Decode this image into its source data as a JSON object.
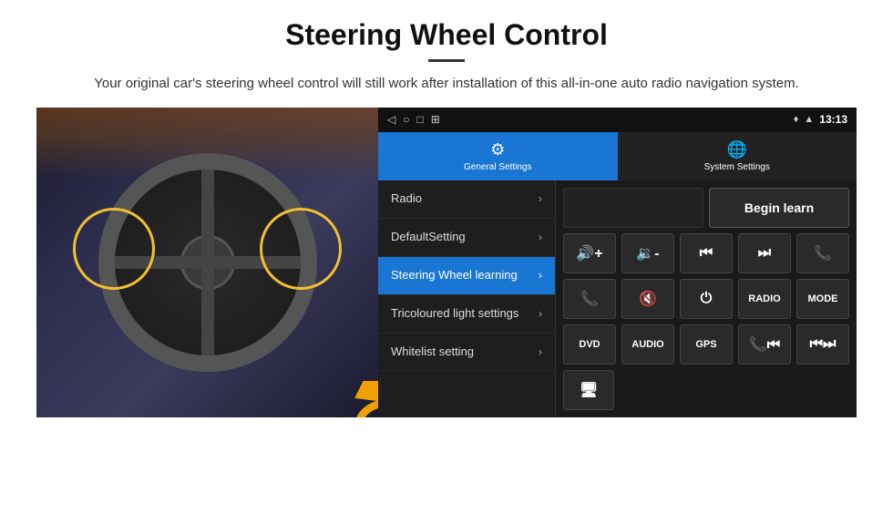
{
  "header": {
    "title": "Steering Wheel Control",
    "divider": true,
    "subtitle": "Your original car's steering wheel control will still work after installation of this all-in-one auto radio navigation system."
  },
  "status_bar": {
    "back_icon": "◁",
    "home_icon": "○",
    "square_icon": "□",
    "grid_icon": "⊞",
    "gps_icon": "♦",
    "signal_icon": "▲",
    "time": "13:13"
  },
  "tabs": [
    {
      "id": "general",
      "icon": "⚙",
      "label": "General Settings",
      "active": true
    },
    {
      "id": "system",
      "icon": "🌐",
      "label": "System Settings",
      "active": false
    }
  ],
  "menu_items": [
    {
      "id": "radio",
      "label": "Radio",
      "active": false
    },
    {
      "id": "default",
      "label": "DefaultSetting",
      "active": false
    },
    {
      "id": "steering",
      "label": "Steering Wheel learning",
      "active": true
    },
    {
      "id": "tricoloured",
      "label": "Tricoloured light settings",
      "active": false
    },
    {
      "id": "whitelist",
      "label": "Whitelist setting",
      "active": false
    }
  ],
  "controls": {
    "row1": {
      "empty_label": "",
      "begin_learn_label": "Begin learn"
    },
    "row2": {
      "btns": [
        "◀◀+",
        "◀◀-",
        "⏮",
        "⏭",
        "📞"
      ]
    },
    "row3": {
      "btns": [
        "📞↙",
        "🔇x",
        "⏻",
        "RADIO",
        "MODE"
      ]
    },
    "row4": {
      "btns": [
        "DVD",
        "AUDIO",
        "GPS",
        "📞⏮",
        "⏮⏭"
      ]
    },
    "row5": {
      "btns": [
        "🖥"
      ]
    }
  }
}
